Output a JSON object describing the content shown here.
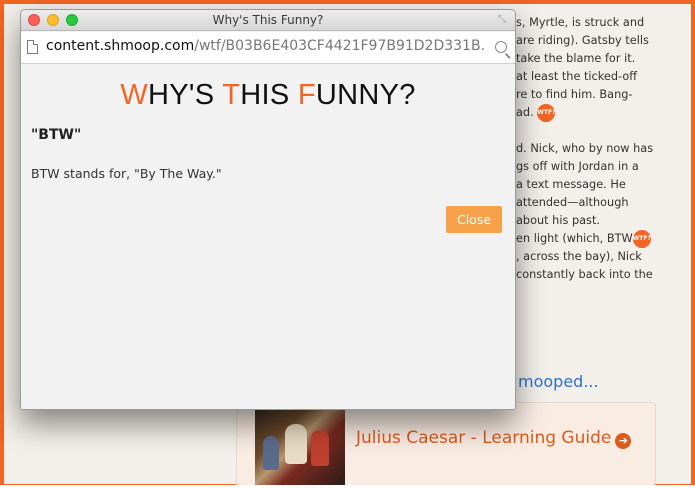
{
  "background": {
    "article_lines": [
      "s, Myrtle, is struck and",
      "are riding). Gatsby tells",
      "take the blame for it.",
      "at least the ticked-off",
      "re to find him. Bang-",
      "ad.",
      "",
      "d. Nick, who by now has",
      "gs off with Jordan in a",
      "a text message. He",
      "attended—although",
      "about his past.",
      "en light (which, BTW",
      ", across the bay), Nick",
      "constantly back into the"
    ],
    "badge_label": "WTF?",
    "link_text": "mooped...",
    "guide_title": "Julius Caesar - Learning Guide",
    "guide_arrow": "➔"
  },
  "window": {
    "title": "Why's This Funny?",
    "url_host": "content.shmoop.com",
    "url_path": "/wtf/B03B6E403CF4421F97B91D2D331B..."
  },
  "popup": {
    "heading": {
      "w": "W",
      "hy": "HY'S ",
      "t": "T",
      "his": "HIS ",
      "f": "F",
      "unny": "UNNY?"
    },
    "term": "\"BTW\"",
    "definition": "BTW stands for, \"By The Way.\"",
    "close_label": "Close"
  },
  "colors": {
    "accent": "#f26522",
    "close_button": "#f7a24a"
  }
}
